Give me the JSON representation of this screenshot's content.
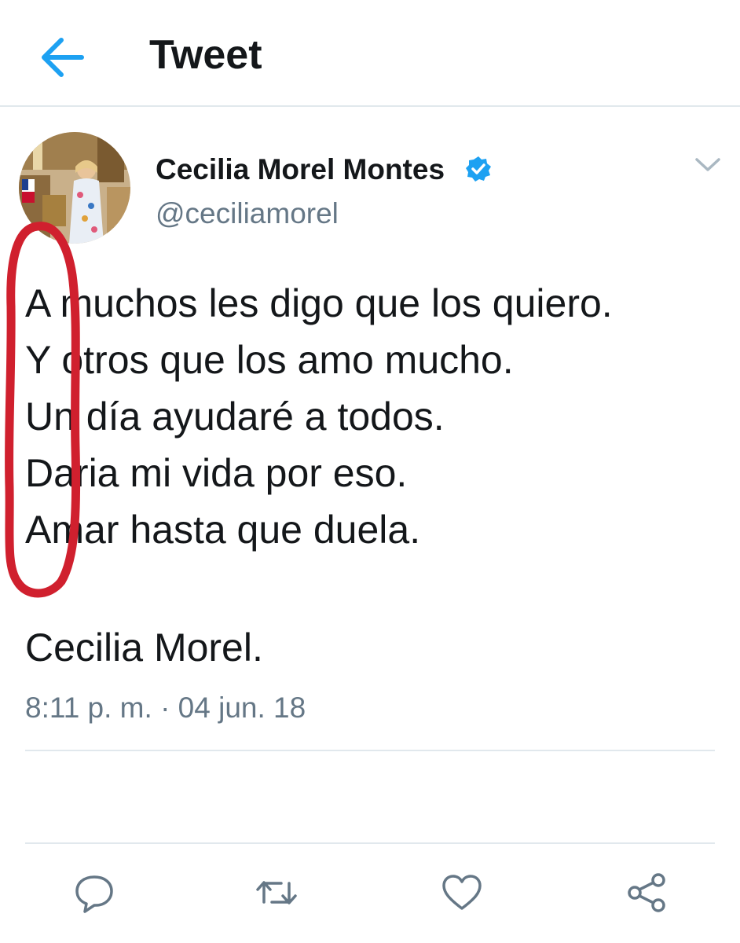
{
  "header": {
    "title": "Tweet",
    "back_icon": "arrow-left-icon"
  },
  "author": {
    "display_name": "Cecilia Morel Montes",
    "handle": "@ceciliamorel",
    "verified": true
  },
  "tweet": {
    "lines": [
      "A  muchos les digo que los quiero.",
      "Y    otros que los amo mucho.",
      "Un  día ayudaré a todos.",
      "Daria mi vida por eso.",
      "Amar hasta que duela."
    ],
    "signature": "Cecilia Morel.",
    "timestamp": "8:11 p. m. · 04 jun. 18"
  },
  "actions": [
    "reply-icon",
    "retweet-icon",
    "like-icon",
    "share-icon"
  ],
  "colors": {
    "accent": "#1da1f2",
    "text": "#14171a",
    "secondary_text": "#657786",
    "divider": "#e1e8ed",
    "annotation": "#d0202e"
  }
}
